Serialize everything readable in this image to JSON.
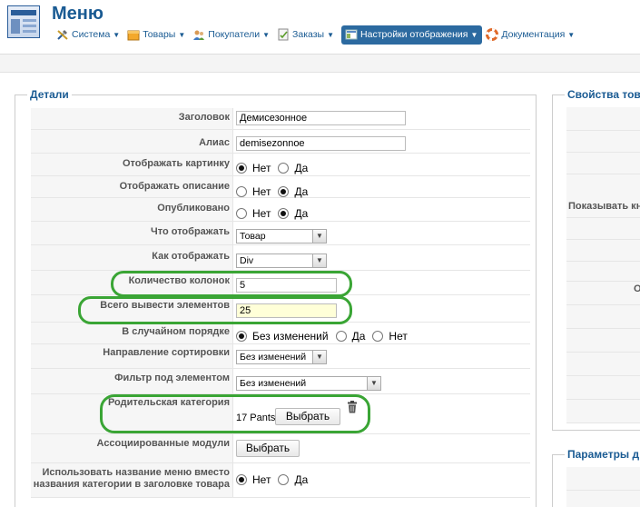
{
  "header": {
    "title": "Меню",
    "menu": [
      {
        "label": "Система",
        "icon": "tools-icon"
      },
      {
        "label": "Товары",
        "icon": "box-icon"
      },
      {
        "label": "Покупатели",
        "icon": "users-icon"
      },
      {
        "label": "Заказы",
        "icon": "orders-icon"
      },
      {
        "label": "Настройки отображения",
        "icon": "display-settings-icon",
        "active": true
      },
      {
        "label": "Документация",
        "icon": "lifebuoy-icon"
      }
    ],
    "accent_color": "#1a5b93",
    "active_menu_color": "#2c6aa0"
  },
  "details": {
    "legend": "Детали",
    "fields": {
      "title": {
        "label": "Заголовок",
        "value": "Демисезонное"
      },
      "alias": {
        "label": "Алиас",
        "value": "demisezonnoe"
      },
      "show_image": {
        "label": "Отображать картинку",
        "options": [
          "Нет",
          "Да"
        ],
        "selected": "Нет"
      },
      "show_description": {
        "label": "Отображать описание",
        "options": [
          "Нет",
          "Да"
        ],
        "selected": "Да"
      },
      "published": {
        "label": "Опубликовано",
        "options": [
          "Нет",
          "Да"
        ],
        "selected": "Да"
      },
      "what_to_show": {
        "label": "Что отображать",
        "value": "Товар"
      },
      "how_to_show": {
        "label": "Как отображать",
        "value": "Div"
      },
      "columns": {
        "label": "Количество колонок",
        "value": "5"
      },
      "total": {
        "label": "Всего вывести элементов",
        "value": "25"
      },
      "random": {
        "label": "В случайном порядке",
        "options": [
          "Без изменений",
          "Да",
          "Нет"
        ],
        "selected": "Без изменений"
      },
      "sort_dir": {
        "label": "Направление сортировки",
        "value": "Без изменений"
      },
      "filter": {
        "label": "Фильтр под элементом",
        "value": "Без изменений"
      },
      "parent_category": {
        "label": "Родительская категория",
        "value": "17 Pants",
        "button": "Выбрать"
      },
      "modules": {
        "label": "Ассоциированные модули",
        "button": "Выбрать"
      },
      "use_menu_name": {
        "label": "Использовать название меню вместо названия категории в заголовке товара",
        "options": [
          "Нет",
          "Да"
        ],
        "selected": "Нет"
      }
    },
    "highlight_color": "#3aa535"
  },
  "right_panel": {
    "legend": "Свойства това",
    "label_show": "Показывать кн",
    "label_o": "О",
    "legend2": "Параметры д"
  }
}
